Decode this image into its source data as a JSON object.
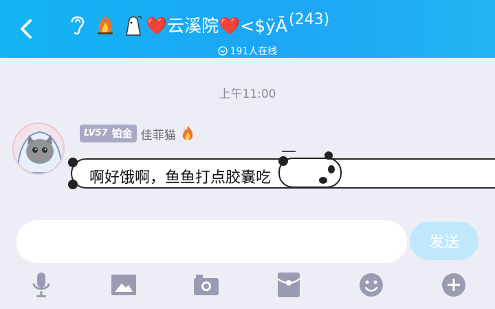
{
  "header": {
    "title": "❤️云溪院❤️<$ÿĀ",
    "member_count": "(243)",
    "online_text": "191人在线",
    "icons": [
      "back-icon",
      "ear-icon",
      "fire-icon",
      "ghost-icon"
    ],
    "bg_color": "#1ca6f4"
  },
  "chat": {
    "timestamp": "上午11:00",
    "messages": [
      {
        "level": "LV57",
        "rank": "铂金",
        "nickname": "佳菲猫",
        "text": "啊好饿啊，鱼鱼打点胶囊吃"
      }
    ]
  },
  "composer": {
    "placeholder": "",
    "send_label": "发送",
    "send_color": "#bfe8fb"
  },
  "toolbar": {
    "icons": [
      "microphone-icon",
      "image-icon",
      "camera-icon",
      "red-packet-icon",
      "emoji-icon",
      "plus-icon"
    ],
    "icon_color": "#9a9ab2"
  }
}
